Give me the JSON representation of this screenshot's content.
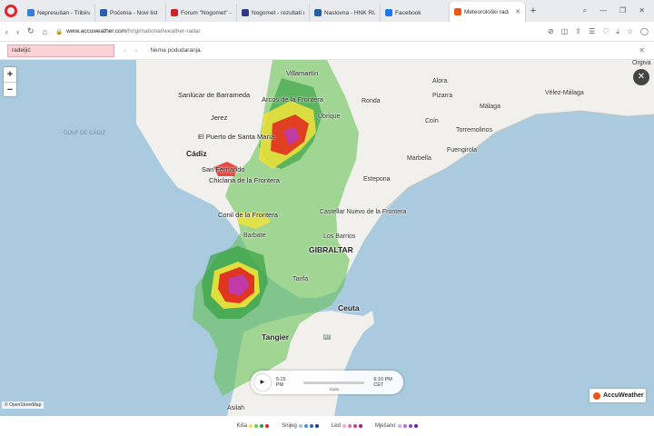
{
  "browser": {
    "tabs": [
      {
        "label": "Nepresušan - Tribina - Inte",
        "color": "#3a7bd5",
        "active": false
      },
      {
        "label": "Početna - Novi list",
        "color": "#2a5db0",
        "active": false
      },
      {
        "label": "Forum \"Nogomet\" - Forum",
        "color": "#c8262b",
        "active": false
      },
      {
        "label": "Nogomet - rezultati uživo",
        "color": "#2a3a8c",
        "active": false
      },
      {
        "label": "Naslovna - HNK RIJEKA",
        "color": "#1e5fa8",
        "active": false
      },
      {
        "label": "Facebook",
        "color": "#1877f2",
        "active": false
      },
      {
        "label": "Meteorološki radar za",
        "color": "#f05514",
        "active": true
      }
    ],
    "url_host": "www.accuweather.com",
    "url_path": "/hr/gi/national/weather-radar"
  },
  "findbar": {
    "query": "radeljić",
    "message": "Nema podudaranja."
  },
  "map": {
    "places": [
      {
        "name": "Villamartín",
        "cls": "big"
      },
      {
        "name": "Alora",
        "cls": ""
      },
      {
        "name": "Orgiva",
        "cls": ""
      },
      {
        "name": "Sanlúcar de Barrameda",
        "cls": "big"
      },
      {
        "name": "Arcos de la Frontera",
        "cls": "big"
      },
      {
        "name": "Pizarra",
        "cls": ""
      },
      {
        "name": "Vélez-Málaga",
        "cls": ""
      },
      {
        "name": "Ronda",
        "cls": ""
      },
      {
        "name": "Ubrique",
        "cls": ""
      },
      {
        "name": "Jerez",
        "cls": "big"
      },
      {
        "name": "Málaga",
        "cls": ""
      },
      {
        "name": "Coín",
        "cls": ""
      },
      {
        "name": "Torremolinos",
        "cls": ""
      },
      {
        "name": "El Puerto de Santa María",
        "cls": "big"
      },
      {
        "name": "Fuengirola",
        "cls": ""
      },
      {
        "name": "Cádiz",
        "cls": "bold"
      },
      {
        "name": "Marbella",
        "cls": ""
      },
      {
        "name": "San Fernando",
        "cls": "big"
      },
      {
        "name": "Chiclana de la Frontera",
        "cls": "big"
      },
      {
        "name": "Estepona",
        "cls": ""
      },
      {
        "name": "Conil de la Frontera",
        "cls": "big"
      },
      {
        "name": "Castellar Nuevo de la Frontera",
        "cls": ""
      },
      {
        "name": "Barbate",
        "cls": ""
      },
      {
        "name": "Los Barrios",
        "cls": ""
      },
      {
        "name": "GIBRALTAR",
        "cls": "bold"
      },
      {
        "name": "Tarifa",
        "cls": ""
      },
      {
        "name": "Ceuta",
        "cls": "bold"
      },
      {
        "name": "Tangier",
        "cls": "bold"
      },
      {
        "name": "Asilah",
        "cls": ""
      }
    ],
    "water_label": "GOLF DE CÁDIZ",
    "road_label": "A7",
    "attribution": "© OpenStreetMap",
    "brand": "AccuWeather"
  },
  "player": {
    "start": "5:15 PM",
    "end": "6:10 PM CET",
    "track_label": "Sada"
  },
  "legend": [
    {
      "label": "Kiša",
      "colors": [
        "#f0e33a",
        "#6bd04a",
        "#2f9e3a",
        "#e0241c"
      ]
    },
    {
      "label": "Snijeg",
      "colors": [
        "#93c7f0",
        "#4a8de0",
        "#2f5fc8",
        "#1e3a9c"
      ]
    },
    {
      "label": "Led",
      "colors": [
        "#f7a8d0",
        "#e86cb0",
        "#d03a90",
        "#a0206c"
      ]
    },
    {
      "label": "Mješano",
      "colors": [
        "#d8a8f0",
        "#b46ee0",
        "#8c3ec8",
        "#6a209c"
      ]
    }
  ],
  "colors": {
    "land": "#f1f0ec",
    "sea": "#aacbdf",
    "radar_light": "#5fbf4a",
    "radar_heavy": "#e0241c",
    "accent": "#f05514"
  }
}
